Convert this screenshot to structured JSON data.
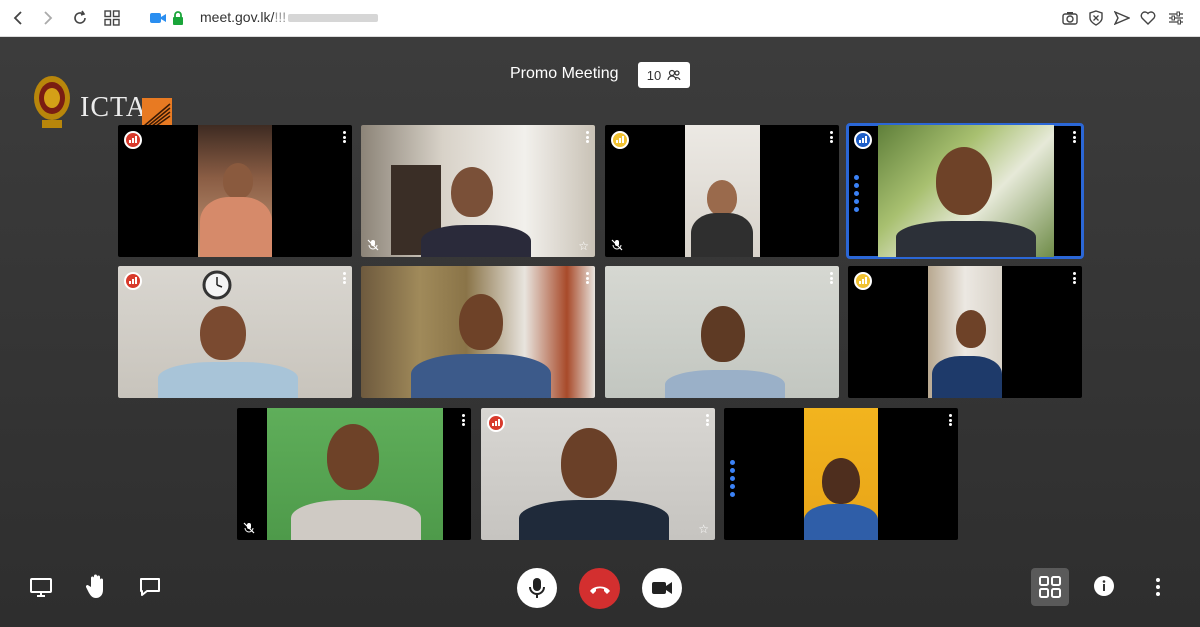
{
  "browser": {
    "url": "meet.gov.lk/",
    "url_masked": "!!!"
  },
  "meeting": {
    "title": "Promo Meeting",
    "participant_count": "10"
  },
  "logo": {
    "text": "ICTA"
  },
  "colors": {
    "signal_red": "#d83a2c",
    "signal_yellow": "#f1c232",
    "signal_blue": "#1d5ec7",
    "active_border": "#2b67d6",
    "hangup": "#d32f2f"
  },
  "participants": [
    {
      "id": 1,
      "signal": "red",
      "muted": false,
      "starred": false,
      "speaking": false
    },
    {
      "id": 2,
      "signal": "none",
      "muted": true,
      "starred": true,
      "speaking": false
    },
    {
      "id": 3,
      "signal": "yellow",
      "muted": true,
      "starred": false,
      "speaking": false
    },
    {
      "id": 4,
      "signal": "blue",
      "muted": false,
      "starred": false,
      "speaking": true,
      "active": true
    },
    {
      "id": 5,
      "signal": "red",
      "muted": false,
      "starred": false,
      "speaking": false
    },
    {
      "id": 6,
      "signal": "none",
      "muted": false,
      "starred": false,
      "speaking": false
    },
    {
      "id": 7,
      "signal": "none",
      "muted": false,
      "starred": false,
      "speaking": false
    },
    {
      "id": 8,
      "signal": "yellow",
      "muted": false,
      "starred": false,
      "speaking": false
    },
    {
      "id": 9,
      "signal": "none",
      "muted": true,
      "starred": false,
      "speaking": false
    },
    {
      "id": 10,
      "signal": "red",
      "muted": false,
      "starred": true,
      "speaking": false
    },
    {
      "id": 11,
      "signal": "none",
      "muted": false,
      "starred": false,
      "speaking": true
    }
  ],
  "toolbar": {
    "left": [
      "screen-share-icon",
      "raise-hand-icon",
      "chat-icon"
    ],
    "center": [
      "microphone-icon",
      "hangup-icon",
      "camera-icon"
    ],
    "right": [
      "tile-view-icon",
      "info-icon",
      "more-icon"
    ]
  }
}
